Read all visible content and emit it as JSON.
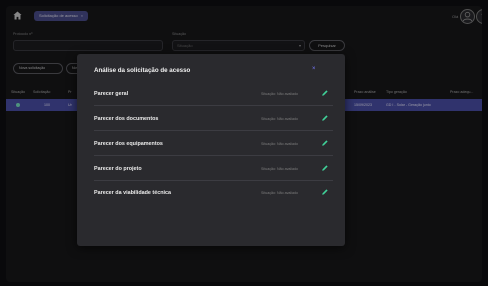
{
  "topbar": {
    "breadcrumb": "Solicitação de acesso",
    "breadcrumb_close": "×",
    "user_name": "Olá",
    "help_label": "?"
  },
  "filters": {
    "protocol_label": "Protocolo nº",
    "situation_label": "Situação",
    "situation_placeholder": "Situação",
    "search_button": "Pesquisar",
    "new_request": "Nova solicitação",
    "second_pill": "Nov"
  },
  "table": {
    "headers": [
      "Situação",
      "Solicitação",
      "Pr",
      "Prazo análise",
      "Tipo geração",
      "Prazo adequ..."
    ],
    "row": {
      "solicitacao": "100",
      "col3": "Ur",
      "prazo": "15/09/2023",
      "tipo": "GD I - Solar - Geração junto"
    }
  },
  "modal": {
    "title": "Análise da solicitação de acesso",
    "close": "×",
    "opinions": [
      {
        "label": "Parecer geral",
        "status": "Situação: Não avaliado"
      },
      {
        "label": "Parecer dos documentos",
        "status": "Situação: Não avaliado"
      },
      {
        "label": "Parecer dos equipamentos",
        "status": "Situação: Não avaliado"
      },
      {
        "label": "Parecer do projeto",
        "status": "Situação: Não avaliado"
      },
      {
        "label": "Parecer da viabilidade técnica",
        "status": "Situação: Não avaliado"
      }
    ]
  },
  "colors": {
    "accent": "#4b4fa8",
    "edit": "#3fd29a"
  }
}
